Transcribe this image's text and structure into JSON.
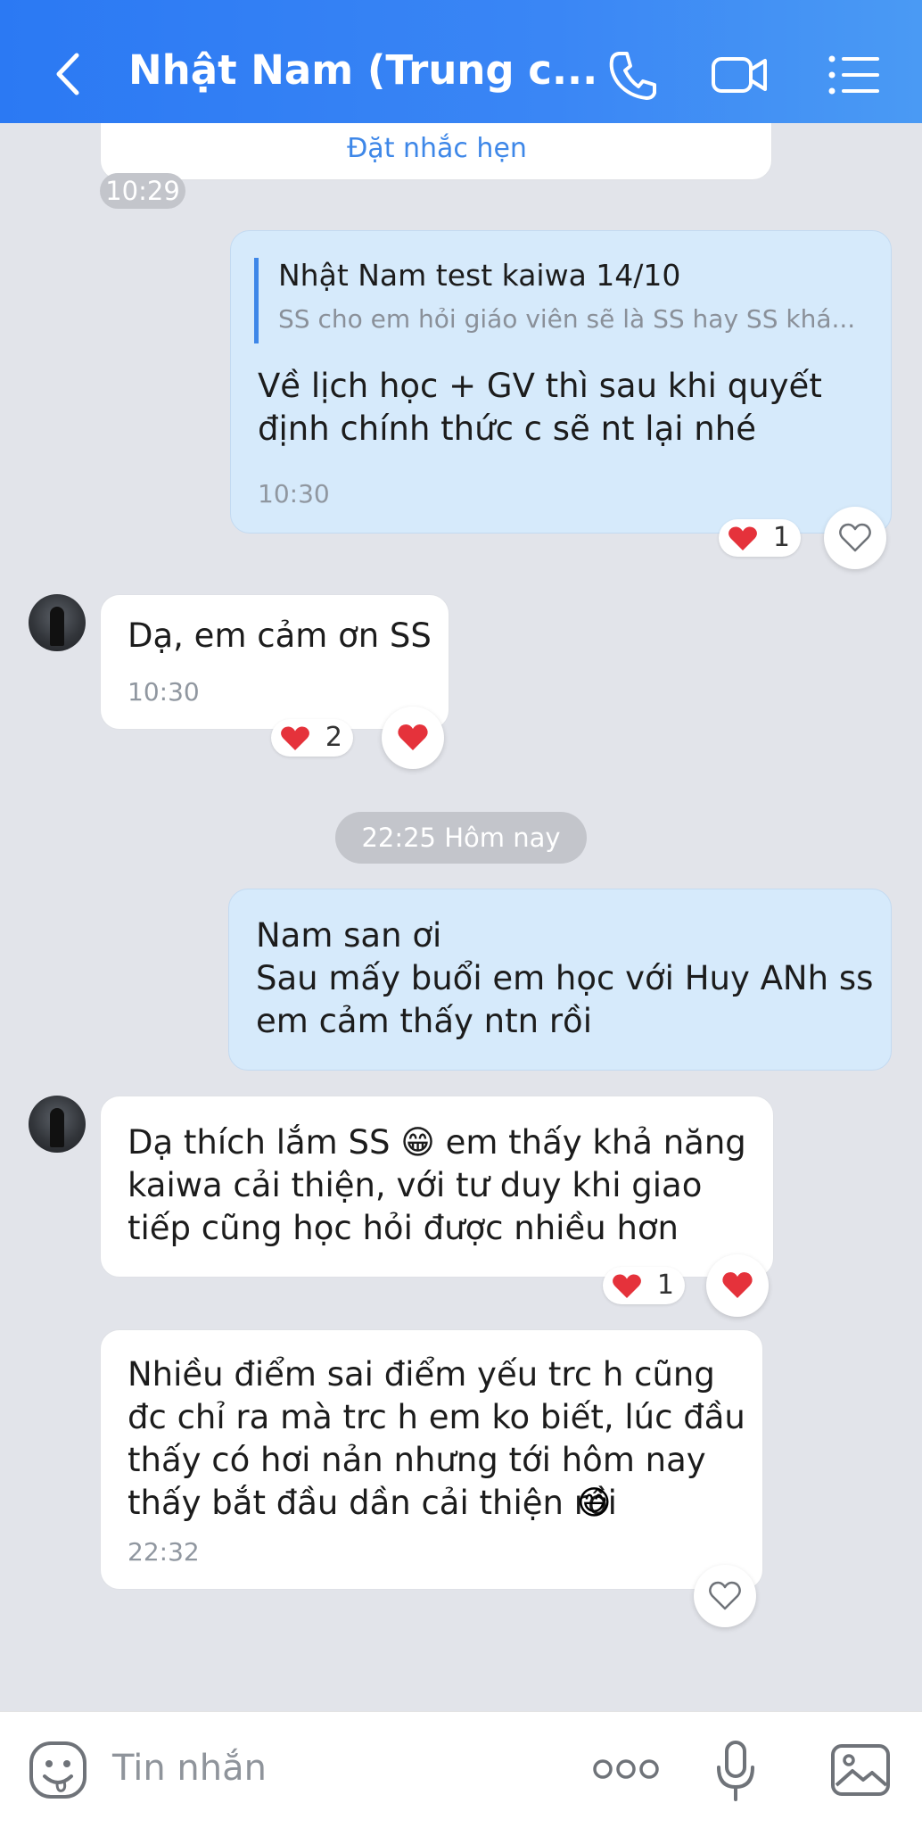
{
  "header": {
    "title": "Nhật Nam (Trung c...",
    "icons": [
      "back-icon",
      "phone-icon",
      "video-call-icon",
      "menu-icon"
    ]
  },
  "partial_message": {
    "link_text": "Đặt nhắc hẹn"
  },
  "time_dividers": {
    "first": "10:29",
    "today": "22:25 Hôm nay"
  },
  "messages": [
    {
      "from": "me",
      "quote": {
        "title": "Nhật Nam test kaiwa 14/10",
        "text": "SS cho em hỏi giáo viên sẽ là SS hay SS khá..."
      },
      "text": "Về lịch học + GV thì sau khi quyết\nđịnh chính thức c sẽ nt lại nhé",
      "time": "10:30",
      "reaction_count": "1"
    },
    {
      "from": "them",
      "text": "Dạ, em cảm ơn SS",
      "time": "10:30",
      "reaction_count": "2"
    },
    {
      "from": "me",
      "text": "Nam san ơi\nSau mấy buổi em học với Huy ANh ss\nem cảm thấy ntn rồi"
    },
    {
      "from": "them",
      "text_part1": "Dạ thích lắm SS",
      "text_emoji": "😁",
      "text_part2": "em thấy khả năng",
      "text_rest": "kaiwa cải thiện, với tư duy khi giao\ntiếp cũng học hỏi được nhiều hơn",
      "reaction_count": "1"
    },
    {
      "from": "them",
      "text": "Nhiều điểm sai điểm yếu trc h cũng\nđc chỉ ra mà trc h em ko biết, lúc đầu\nthấy có hơi nản nhưng tới hôm nay\nthấy bắt đầu dần cải thiện rồi",
      "text_emoji": "😅",
      "time": "22:32"
    }
  ],
  "composer": {
    "placeholder": "Tin nhắn",
    "icons": [
      "sticker-icon",
      "more-icon",
      "microphone-icon",
      "image-icon"
    ]
  },
  "colors": {
    "header_start": "#2b79f3",
    "header_end": "#4a9af4",
    "sent_bubble": "#d6eafb",
    "received_bubble": "#ffffff",
    "background": "#e2e4ea",
    "heart": "#e5323b",
    "quote_bar": "#3e87e8"
  }
}
